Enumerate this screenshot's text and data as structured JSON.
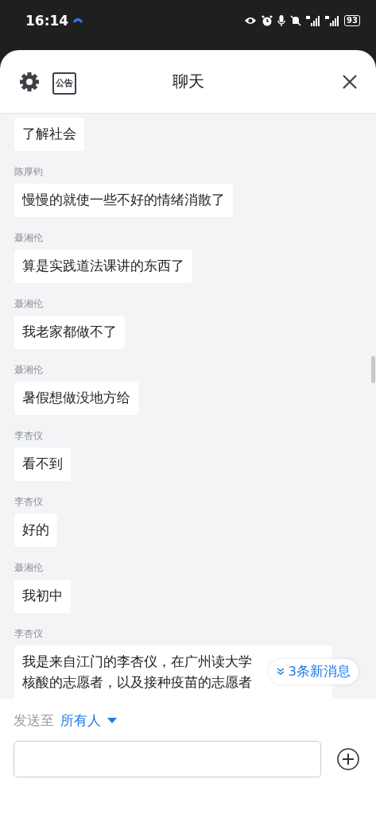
{
  "status_bar": {
    "time": "16:14",
    "battery": "93"
  },
  "chat_panel": {
    "title": "聊天",
    "notice_button": "公告",
    "messages": [
      {
        "text": [
          "了解社会"
        ]
      },
      {
        "sender": "陈厚钧",
        "text": [
          "慢慢的就使一些不好的情绪消散了"
        ]
      },
      {
        "sender": "聂湘伦",
        "text": [
          "算是实践道法课讲的东西了"
        ]
      },
      {
        "sender": "聂湘伦",
        "text": [
          "我老家都做不了"
        ]
      },
      {
        "sender": "聂湘伦",
        "text": [
          "暑假想做没地方给"
        ]
      },
      {
        "sender": "李杏仪",
        "text": [
          "看不到"
        ]
      },
      {
        "sender": "李杏仪",
        "text": [
          "好的"
        ]
      },
      {
        "sender": "聂湘伦",
        "text": [
          "我初中"
        ]
      },
      {
        "sender": "李杏仪",
        "text": [
          "我是来自江门的李杏仪，在广州读大学",
          "核酸的志愿者，以及接种疫苗的志愿者"
        ]
      }
    ],
    "new_messages_badge": "3条新消息",
    "composer": {
      "send_to_label": "发送至",
      "recipient": "所有人"
    }
  }
}
